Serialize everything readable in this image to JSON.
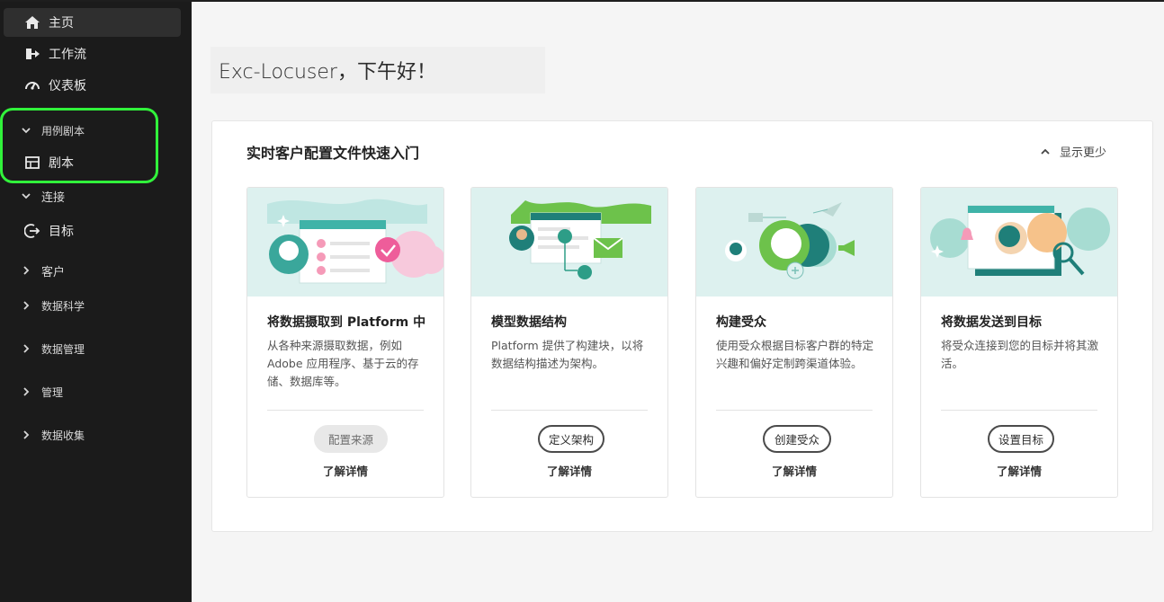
{
  "sidebar": {
    "home": "主页",
    "workflows": "工作流",
    "dashboards": "仪表板",
    "playbook_section": "用例剧本",
    "playbooks": "剧本",
    "connections": "连接",
    "destinations": "目标",
    "customer": "客户",
    "data_science": "数据科学",
    "data_management": "数据管理",
    "administration": "管理",
    "data_collection": "数据收集"
  },
  "greeting": "Exc-Locuser，下午好！",
  "panel": {
    "title": "实时客户配置文件快速入门",
    "toggle": "显示更少"
  },
  "cards": [
    {
      "title": "将数据摄取到 Platform 中",
      "description": "从各种来源摄取数据，例如 Adobe 应用程序、基于云的存储、数据库等。",
      "button": "配置来源",
      "button_disabled": true,
      "link": "了解详情"
    },
    {
      "title": "模型数据结构",
      "description": "Platform 提供了构建块，以将数据结构描述为架构。",
      "button": "定义架构",
      "link": "了解详情"
    },
    {
      "title": "构建受众",
      "description": "使用受众根据目标客户群的特定兴趣和偏好定制跨渠道体验。",
      "button": "创建受众",
      "link": "了解详情"
    },
    {
      "title": "将数据发送到目标",
      "description": "将受众连接到您的目标并将其激活。",
      "button": "设置目标",
      "link": "了解详情"
    }
  ],
  "icons": {
    "home": "home-icon",
    "workflows": "workflow-icon",
    "dashboards": "dashboard-gauge-icon",
    "playbooks": "playbook-icon",
    "destinations": "destination-icon",
    "chevron": "chevron-icon"
  },
  "colors": {
    "sidebar_bg": "#1b1b1b",
    "highlight": "#31f23b",
    "teal": "#1f9e94",
    "illus_bg": "#ddf1ef"
  }
}
